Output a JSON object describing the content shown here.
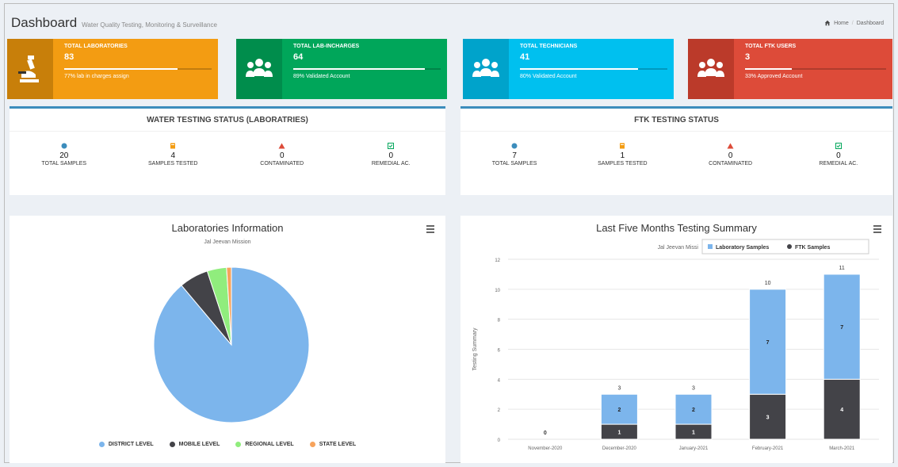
{
  "header": {
    "title": "Dashboard",
    "subtitle": "Water Quality Testing, Monitoring & Surveillance",
    "breadcrumb": [
      "Home",
      "Dashboard"
    ]
  },
  "info_boxes": [
    {
      "label": "TOTAL LABORATORIES",
      "value": "83",
      "progress": 0.77,
      "desc": "77% lab in charges assign",
      "color": "#f39c12",
      "icon": "microscope-icon"
    },
    {
      "label": "TOTAL LAB-INCHARGES",
      "value": "64",
      "progress": 0.89,
      "desc": "89% Validated Account",
      "color": "#00a65a",
      "icon": "users-icon"
    },
    {
      "label": "TOTAL TECHNICIANS",
      "value": "41",
      "progress": 0.8,
      "desc": "80% Validated Account",
      "color": "#00c0ef",
      "icon": "users-icon"
    },
    {
      "label": "TOTAL FTK USERS",
      "value": "3",
      "progress": 0.33,
      "desc": "33% Approved Account",
      "color": "#dd4b39",
      "icon": "users-icon"
    }
  ],
  "lab_status": {
    "title": "WATER TESTING STATUS (LABORATRIES)",
    "stats": [
      {
        "value": "20",
        "label": "TOTAL SAMPLES",
        "icon": "circle-info-icon",
        "color": "#3c8dbc"
      },
      {
        "value": "4",
        "label": "SAMPLES TESTED",
        "icon": "clipboard-icon",
        "color": "#f39c12"
      },
      {
        "value": "0",
        "label": "CONTAMINATED",
        "icon": "warning-icon",
        "color": "#dd4b39"
      },
      {
        "value": "0",
        "label": "REMEDIAL AC.",
        "icon": "check-square-icon",
        "color": "#00a65a"
      }
    ]
  },
  "ftk_status": {
    "title": "FTK TESTING STATUS",
    "stats": [
      {
        "value": "7",
        "label": "TOTAL SAMPLES",
        "icon": "circle-info-icon",
        "color": "#3c8dbc"
      },
      {
        "value": "1",
        "label": "SAMPLES TESTED",
        "icon": "clipboard-icon",
        "color": "#f39c12"
      },
      {
        "value": "0",
        "label": "CONTAMINATED",
        "icon": "warning-icon",
        "color": "#dd4b39"
      },
      {
        "value": "0",
        "label": "REMEDIAL AC.",
        "icon": "check-square-icon",
        "color": "#00a65a"
      }
    ]
  },
  "chart_data": [
    {
      "type": "pie",
      "title": "Laboratories Information",
      "subtitle": "Jal Jeevan Mission",
      "slices": [
        {
          "name": "DISTRICT LEVEL",
          "value": 88,
          "color": "#7cb5ec"
        },
        {
          "name": "MOBILE LEVEL",
          "value": 6,
          "color": "#434348"
        },
        {
          "name": "REGIONAL LEVEL",
          "value": 4,
          "color": "#90ed7d"
        },
        {
          "name": "STATE LEVEL",
          "value": 1,
          "color": "#f7a35c"
        }
      ]
    },
    {
      "type": "bar",
      "stacked": true,
      "title": "Last Five Months Testing Summary",
      "subtitle": "Jal Jeevan Mission",
      "ylabel": "Testing Summary",
      "ylim": [
        0,
        12
      ],
      "yticks": [
        0,
        2,
        4,
        6,
        8,
        10,
        12
      ],
      "categories": [
        "November-2020",
        "December-2020",
        "January-2021",
        "February-2021",
        "March-2021"
      ],
      "totals": [
        0,
        3,
        3,
        10,
        11
      ],
      "series": [
        {
          "name": "Laboratory Samples",
          "values": [
            0,
            2,
            2,
            7,
            7
          ],
          "color": "#7cb5ec"
        },
        {
          "name": "FTK Samples",
          "values": [
            0,
            1,
            1,
            3,
            4
          ],
          "color": "#434348"
        }
      ]
    }
  ]
}
